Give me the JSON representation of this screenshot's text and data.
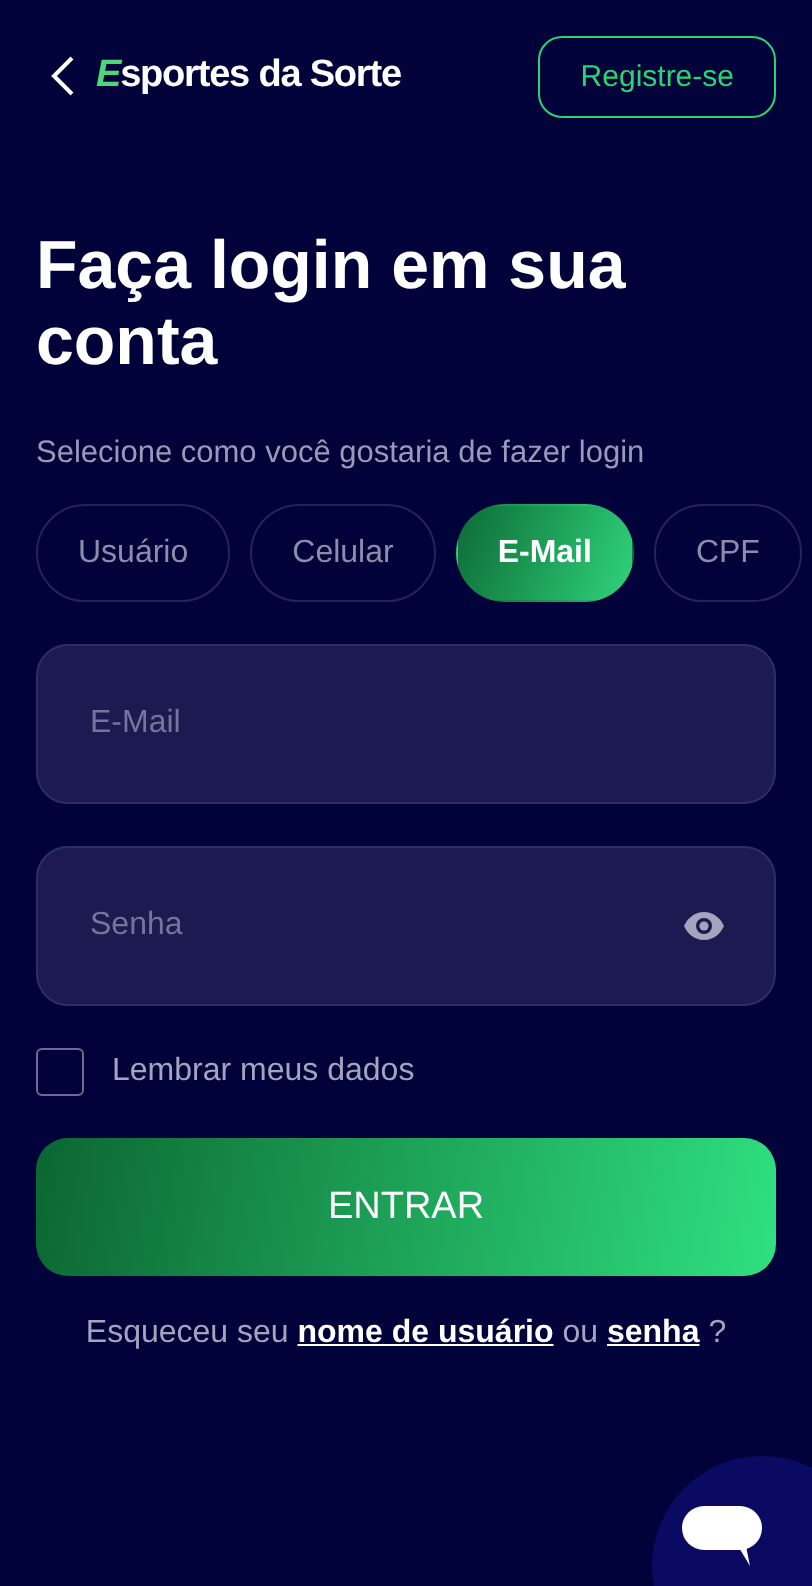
{
  "header": {
    "logo": "Esportes da Sorte",
    "register_button": "Registre-se"
  },
  "title": "Faça login em sua conta",
  "subtitle": "Selecione como você gostaria de fazer login",
  "tabs": [
    {
      "label": "Usuário",
      "selected": false
    },
    {
      "label": "Celular",
      "selected": false
    },
    {
      "label": "E-Mail",
      "selected": true
    },
    {
      "label": "CPF",
      "selected": false
    }
  ],
  "fields": [
    {
      "placeholder": "E-Mail",
      "kind": "text"
    },
    {
      "placeholder": "Senha",
      "kind": "password"
    }
  ],
  "remember": {
    "label": "Lembrar meus dados",
    "checked": false
  },
  "submit_button": "ENTRAR",
  "forgot": {
    "prefix": "Esqueceu seu",
    "username_link": "nome de usuário",
    "middle": "ou",
    "password_link": "senha",
    "suffix": "?"
  }
}
